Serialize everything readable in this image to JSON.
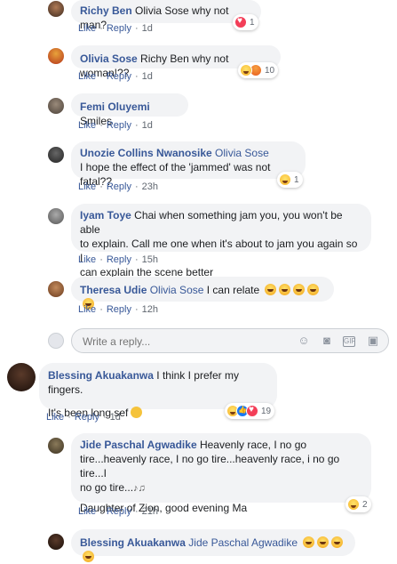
{
  "comments": [
    {
      "name": "Richy Ben",
      "tag": "",
      "text": "Olivia Sose why not man?",
      "like": "Like",
      "reply": "Reply",
      "time": "1d",
      "reactions": "1"
    },
    {
      "name": "Olivia Sose",
      "tag": "",
      "text": "Richy Ben why not woman!??",
      "like": "Like",
      "reply": "Reply",
      "time": "1d",
      "reactions": "10"
    },
    {
      "name": "Femi Oluyemi",
      "tag": "",
      "text": "Smiles",
      "like": "Like",
      "reply": "Reply",
      "time": "1d"
    },
    {
      "name": "Unozie Collins Nwanosike",
      "tag": "Olivia Sose",
      "text": "I hope the effect of the 'jammed' was not fatal??",
      "like": "Like",
      "reply": "Reply",
      "time": "23h",
      "reactions": "1"
    },
    {
      "name": "Iyam Toye",
      "tag": "",
      "text_l1": "Chai when something jam you, you won't be able",
      "text_l2": "to explain. Call me one when it's about to jam you again so I",
      "text_l3": "can explain the scene better",
      "like": "Like",
      "reply": "Reply",
      "time": "15h"
    },
    {
      "name": "Theresa Udie",
      "tag": "Olivia Sose",
      "text": "I can relate",
      "like": "Like",
      "reply": "Reply",
      "time": "12h"
    }
  ],
  "reply_box": {
    "placeholder": "Write a reply..."
  },
  "top_comment": {
    "name": "Blessing Akuakanwa",
    "text": "I think I prefer my fingers.",
    "text2": "It's been long sef",
    "like": "Like",
    "reply": "Reply",
    "time": "1d",
    "reactions": "19"
  },
  "sub_comments": [
    {
      "name": "Jide Paschal Agwadike",
      "text_l1": "Heavenly race, I no go",
      "text_l2": "tire...heavenly race, I no go tire...heavenly race, i no go tire...I",
      "text_l3": "no go tire...",
      "text2": "Daughter of Zion, good evening Ma",
      "like": "Like",
      "reply": "Reply",
      "time": "21h",
      "reactions": "2"
    },
    {
      "name": "Blessing Akuakanwa",
      "tag": "Jide Paschal Agwadike"
    }
  ],
  "colors": {
    "link": "#385898",
    "bubble": "#f2f3f5",
    "meta": "#606770"
  }
}
